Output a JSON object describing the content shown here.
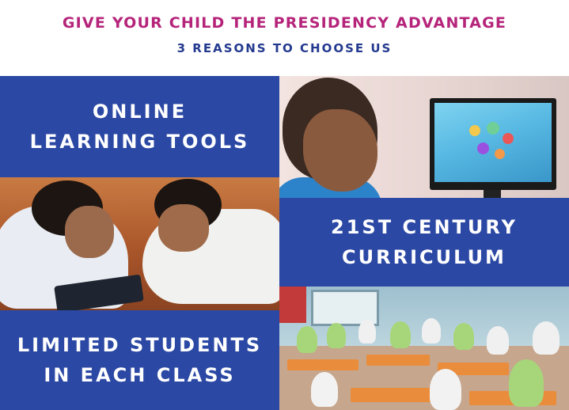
{
  "header": {
    "headline": "GIVE YOUR CHILD THE PRESIDENCY ADVANTAGE",
    "subhead": "3 REASONS TO CHOOSE US"
  },
  "reasons": [
    {
      "line1": "ONLINE",
      "line2": "LEARNING TOOLS"
    },
    {
      "line1": "21ST CENTURY",
      "line2": "CURRICULUM"
    },
    {
      "line1": "LIMITED STUDENTS",
      "line2": "IN EACH CLASS"
    }
  ],
  "colors": {
    "headline": "#b5247a",
    "subhead": "#243a8f",
    "panel_blue": "#2b48a4"
  }
}
